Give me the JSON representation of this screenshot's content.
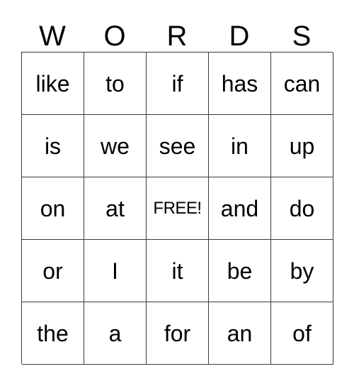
{
  "card": {
    "title_letters": [
      "W",
      "O",
      "R",
      "D",
      "S"
    ],
    "rows": [
      [
        "like",
        "to",
        "if",
        "has",
        "can"
      ],
      [
        "is",
        "we",
        "see",
        "in",
        "up"
      ],
      [
        "on",
        "at",
        "FREE!",
        "and",
        "do"
      ],
      [
        "or",
        "I",
        "it",
        "be",
        "by"
      ],
      [
        "the",
        "a",
        "for",
        "an",
        "of"
      ]
    ],
    "free_space": {
      "label": "FREE!",
      "row_index": 2,
      "column_index": 2
    },
    "colors": {
      "grid_line": "#3a3a3a",
      "text": "#000000",
      "background": "#ffffff"
    }
  }
}
